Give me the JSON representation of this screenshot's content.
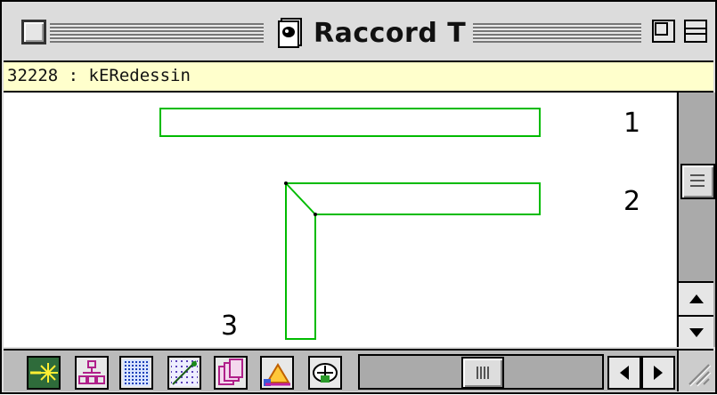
{
  "window": {
    "title": "Raccord T",
    "icon": "document-app-icon"
  },
  "infobar": {
    "text": "32228 : kERedessin"
  },
  "canvas": {
    "stroke_color": "#00bb00",
    "labels": [
      "1",
      "2",
      "3"
    ]
  },
  "toolbar": {
    "tools": [
      "select-sparkle-icon",
      "hierarchy-icon",
      "dotted-pattern-icon",
      "scatter-pattern-icon",
      "layers-icon",
      "measure-icon",
      "3d-view-icon"
    ]
  },
  "scrollbars": {
    "vertical": [
      "scroll-up-icon",
      "scroll-down-icon"
    ],
    "horizontal": [
      "scroll-left-icon",
      "scroll-right-icon"
    ]
  }
}
